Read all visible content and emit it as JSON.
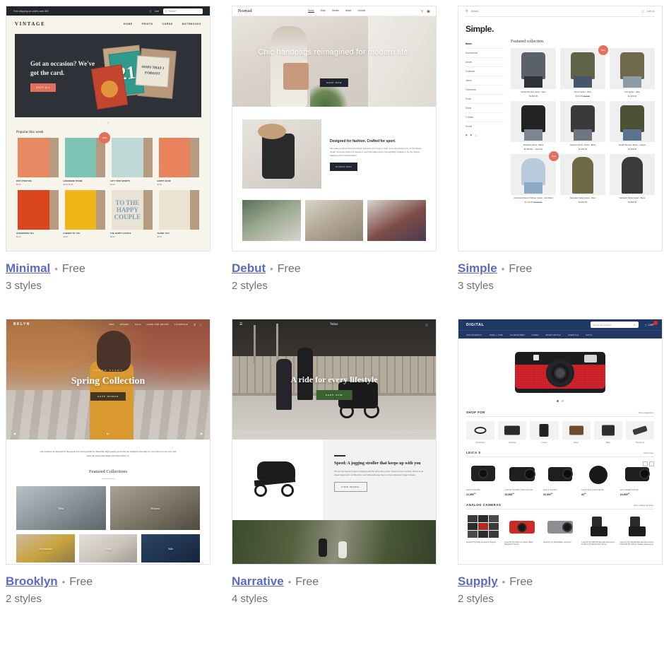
{
  "themes": [
    {
      "name": "Minimal",
      "price": "Free",
      "styles": "3 styles",
      "separator": "•",
      "preview": {
        "kind": "vintage",
        "announcement": "Free shipping on orders over $50",
        "cart": "Cart",
        "search_placeholder": "Search",
        "logo": "VINTAGE",
        "nav": [
          "HOME",
          "PRINTS",
          "CARDS",
          "NOTEBOOKS"
        ],
        "hero_heading": "Got an occasion? We've got the card.",
        "hero_button": "SHOP ALL",
        "card_art": [
          "21",
          "OOPS THAT I FORGOT"
        ],
        "section_title": "Popular this week",
        "sale_label": "SALE",
        "products": [
          {
            "title": "STAY POSITIVE",
            "price": "$6.00"
          },
          {
            "title": "LEMONADE STAND",
            "price": "$6.00 $4.00"
          },
          {
            "title": "LIFT YOUR SPIRITS",
            "price": "$6.00"
          },
          {
            "title": "HAPPY HOUR",
            "price": "$6.00"
          },
          {
            "title": "AFTERNOON TEA",
            "price": "$6.00"
          },
          {
            "title": "CHEERS TO YOU",
            "price": "$6.00"
          },
          {
            "title": "THE HAPPY COUPLE",
            "price": "$6.00"
          },
          {
            "title": "THANK YOU",
            "price": "$6.00"
          }
        ]
      }
    },
    {
      "name": "Debut",
      "price": "Free",
      "styles": "2 styles",
      "separator": "•",
      "preview": {
        "kind": "debut",
        "logo": "Nomad",
        "nav": [
          "Home",
          "Shop",
          "Stories",
          "About",
          "Contact"
        ],
        "hero_heading": "Chic handbags reimagined for modern life.",
        "hero_button": "SHOP NOW",
        "feature_heading": "Designed for fashion. Crafted for sport.",
        "feature_body": "We make products that effortlessly transition from day to night. From the board room to the fitness studio, and everywhere in between, each Nomade piece is thoughtfully created to be the perfect balance of form and function.",
        "feature_button": "STUDIO BAG"
      }
    },
    {
      "name": "Simple",
      "price": "Free",
      "styles": "3 styles",
      "separator": "•",
      "preview": {
        "kind": "simple",
        "search_placeholder": "Search",
        "cart": "Cart (1)",
        "logo": "Simple.",
        "sidebar": [
          "Home",
          "Accessories",
          "Denim",
          "Footwear",
          "Jeans",
          "Outerwear",
          "Pants",
          "Shirts",
          "T-Shirts",
          "Shorts"
        ],
        "collection_title": "Featured collection",
        "sale_label": "Sale",
        "products": [
          {
            "name": "Stealth Bomber Jacket - Navy",
            "price": "$1,500.95"
          },
          {
            "name": "Storm Jacket - Olive",
            "price": "$343.95",
            "compare": "$800.95",
            "on_sale": true
          },
          {
            "name": "Gulf Jacket - Olive",
            "price": "$1,299.95"
          },
          {
            "name": "Wolfpack Jacket - Black",
            "price": "$1,500.95 — Sold Out"
          },
          {
            "name": "Operator Denim Jacket - Black",
            "price": "$1,200.95"
          },
          {
            "name": "Stealth Bomber Jacket - Fatigue",
            "price": "$1,599.95"
          },
          {
            "name": "Compound Denim Pullover Jacket - Acid Wash",
            "price": "$1,220.95",
            "compare": "$1,900.95",
            "on_sale": true
          },
          {
            "name": "Navigator Parka Jacket - Olive",
            "price": "$1,900.95"
          },
          {
            "name": "Navigator Parka Jacket - Black",
            "price": "$1,899.95"
          }
        ]
      }
    },
    {
      "name": "Brooklyn",
      "price": "Free",
      "styles": "2 styles",
      "separator": "•",
      "preview": {
        "kind": "brooklyn",
        "logo": "BKLYN",
        "nav": [
          "MEN",
          "WOMEN",
          "SALE",
          "HOME AND DECOR",
          "LOOKBOOK"
        ],
        "hero_eyebrow": "FRESH START",
        "hero_heading": "Spring Collection",
        "hero_button": "SHOP WOMEN",
        "intro": "Our products are inspired by the people and world around us. Beautiful, high quality goods that are designed especially for you. Discover our story and meet the people that make our brand what it is.",
        "intro_link": "our story",
        "collections_title": "Featured Collections",
        "collections": [
          "Men",
          "Women",
          "Accessories",
          "Home",
          "Sale"
        ]
      }
    },
    {
      "name": "Narrative",
      "price": "Free",
      "styles": "4 styles",
      "separator": "•",
      "preview": {
        "kind": "narrative",
        "logo": "Veloz",
        "hero_heading": "A ride for every lifestyle",
        "hero_button": "SHOP NOW",
        "caption_left": "THE NEW STANDARD",
        "caption_right": "SPEED STROLLER",
        "feature_heading": "Speed: A jogging stroller that keeps up with you",
        "feature_body": "The all-new Speed model is designed with the active life in mind. Speed moves smoothly thanks to all-wheel suspension, air-filled tires, and folds well away due to a new ergonomic trigger release.",
        "feature_button": "VIEW MODEL"
      }
    },
    {
      "name": "Supply",
      "price": "Free",
      "styles": "2 styles",
      "separator": "•",
      "preview": {
        "kind": "supply",
        "logo": "DIGITAL",
        "search_placeholder": "Search all products...",
        "cart": "CART",
        "cart_count": "1",
        "nav": [
          "PHOTOGRAPHY",
          "VIDEO + CINE",
          "ACCESSORIES",
          "CASES",
          "SPORT OPTICS",
          "LIFESTYLE",
          "GIFTS"
        ],
        "shop_for_title": "SHOP FOR",
        "shop_for_link": "More categories ›",
        "categories": [
          "Accessories",
          "Cameras",
          "Lenses",
          "Cases",
          "Bags",
          "Thumbs up"
        ],
        "leica_title": "LEICA S",
        "leica_link": "More leica ›",
        "leica_products": [
          {
            "name": "Leica S (Typ 006)",
            "price": "21,950",
            "cents": "00"
          },
          {
            "name": "Leica SL (Typ 006) / 70mm lens Set",
            "price": "15,990",
            "cents": "00"
          },
          {
            "name": "Leica S (Typ 007)",
            "price": "16,900",
            "cents": "00"
          },
          {
            "name": "Leica S lens & Lens Cap Kit",
            "price": "60",
            "cents": "00"
          },
          {
            "name": "Leica S Edition 100 Set",
            "price": "24,500",
            "cents": "00"
          }
        ],
        "analog_title": "ANALOG CAMERAS",
        "analog_link": "More analog cameras ›",
        "analog_products": [
          {
            "name": "Leica M (Typ 240) Accessory Program"
          },
          {
            "name": "Leica M (Typ 240) 4 in Cecite, Black Body/Red camera"
          },
          {
            "name": "Leica M (Typ 240) Edition Leica 007"
          },
          {
            "name": "Leica M (Typ 262) Bundle with Summicron-M 35mm f/2, Elmarit 28 x 28 set"
          },
          {
            "name": "Leica M (Typ 240) Bundle with Summicron-M Elmarit 28 x 28 set, Aviation Camera set"
          }
        ]
      }
    }
  ]
}
